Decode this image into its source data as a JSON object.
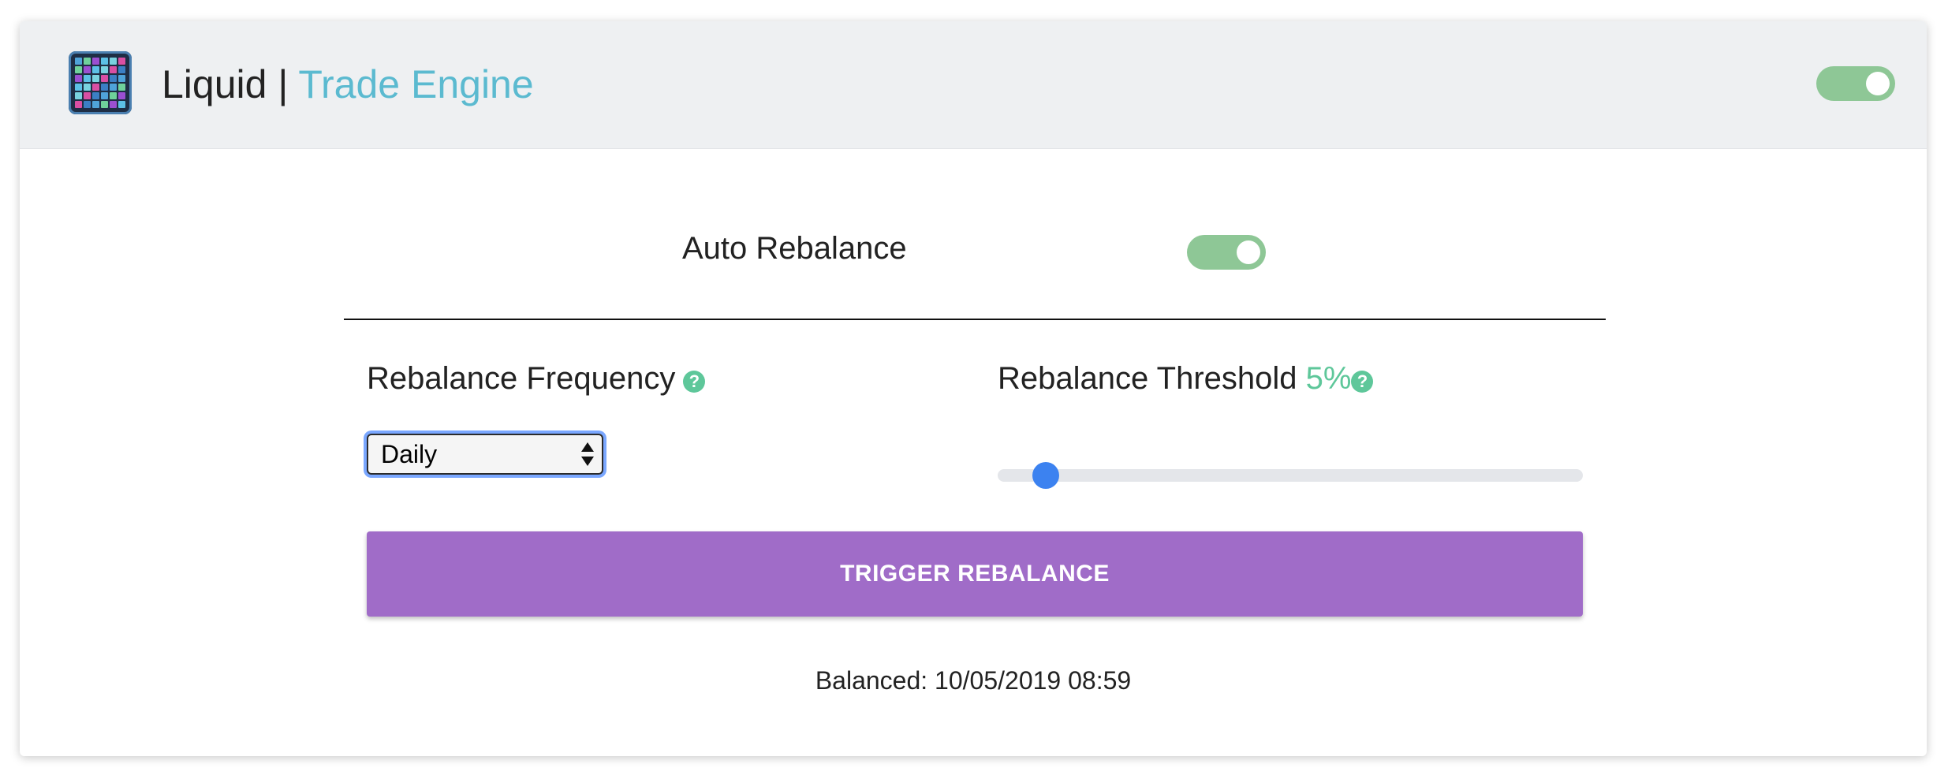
{
  "header": {
    "brand_name": "Liquid",
    "separator": " | ",
    "brand_product": "Trade Engine",
    "power_toggle_on": true,
    "logo_icon": "grid-app-icon"
  },
  "auto_rebalance": {
    "label": "Auto Rebalance",
    "enabled": true
  },
  "frequency": {
    "label": "Rebalance Frequency",
    "help_icon": "question-circle-icon",
    "help_glyph": "?",
    "selected": "Daily"
  },
  "threshold": {
    "label": "Rebalance Threshold",
    "value_text": "5%",
    "help_icon": "question-circle-icon",
    "help_glyph": "?",
    "slider_fraction": 0.05
  },
  "trigger_button": {
    "label": "TRIGGER REBALANCE"
  },
  "status": {
    "balanced_text": "Balanced: 10/05/2019 08:59"
  },
  "colors": {
    "accent_teal": "#5bbad0",
    "toggle_on": "#8ec796",
    "help_green": "#5ec79a",
    "button_purple": "#a06cc8",
    "slider_blue": "#3c82f0"
  }
}
